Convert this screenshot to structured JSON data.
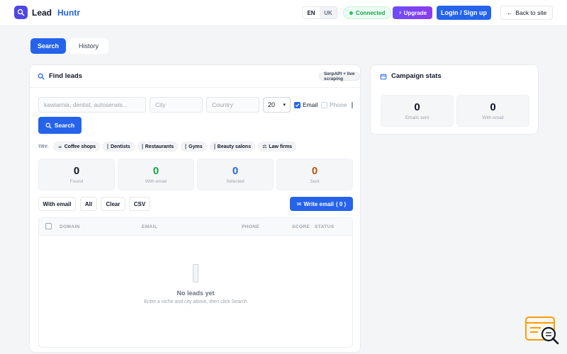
{
  "header": {
    "brand_name": "Lead",
    "brand_accent": "Huntr",
    "languages": [
      "EN",
      "UK"
    ],
    "active_language": "EN",
    "status": "Connected",
    "upgrade_label": "Upgrade",
    "login_label": "Login / Sign up",
    "back_label": "Back to site"
  },
  "tabs": [
    {
      "label": "Search",
      "active": true
    },
    {
      "label": "History",
      "active": false
    }
  ],
  "find": {
    "title": "Find leads",
    "badge": "SerpAPI + live scraping",
    "niche_placeholder": "kawiarnia, dentist, autoserwis...",
    "city_placeholder": "City",
    "country_placeholder": "Country",
    "count_value": "20",
    "email_label": "Email",
    "email_checked": true,
    "phone_label": "Phone",
    "phone_checked": false,
    "search_label": "Search",
    "try_label": "TRY:",
    "suggestions": [
      {
        "label": "Coffee shops",
        "icon": "coffee-icon"
      },
      {
        "label": "Dentists",
        "icon": "tooth-icon"
      },
      {
        "label": "Restaurants",
        "icon": "plate-icon"
      },
      {
        "label": "Gyms",
        "icon": "dumbbell-icon"
      },
      {
        "label": "Beauty salons",
        "icon": "lipstick-icon"
      },
      {
        "label": "Law firms",
        "icon": "scales-icon"
      }
    ]
  },
  "stats": [
    {
      "value": "0",
      "label": "Found",
      "color": "#111827"
    },
    {
      "value": "0",
      "label": "With email",
      "color": "#16a34a"
    },
    {
      "value": "0",
      "label": "Selected",
      "color": "#2563eb"
    },
    {
      "value": "0",
      "label": "Sent",
      "color": "#b45309"
    }
  ],
  "filters": {
    "with_email": "With email",
    "all": "All",
    "clear": "Clear",
    "csv": "CSV",
    "write_email": "Write email",
    "write_count": "( 0 )"
  },
  "table": {
    "columns": [
      "DOMAIN",
      "EMAIL",
      "PHONE",
      "SCORE",
      "STATUS"
    ],
    "empty_title": "No leads yet",
    "empty_subtitle": "Enter a niche and city above, then click Search"
  },
  "campaign": {
    "title": "Campaign stats",
    "stats": [
      {
        "value": "0",
        "label": "Emails sent"
      },
      {
        "value": "0",
        "label": "With email"
      }
    ]
  },
  "colors": {
    "accent": "#2563eb",
    "upgrade": "#7c3aed",
    "success": "#16a34a"
  }
}
